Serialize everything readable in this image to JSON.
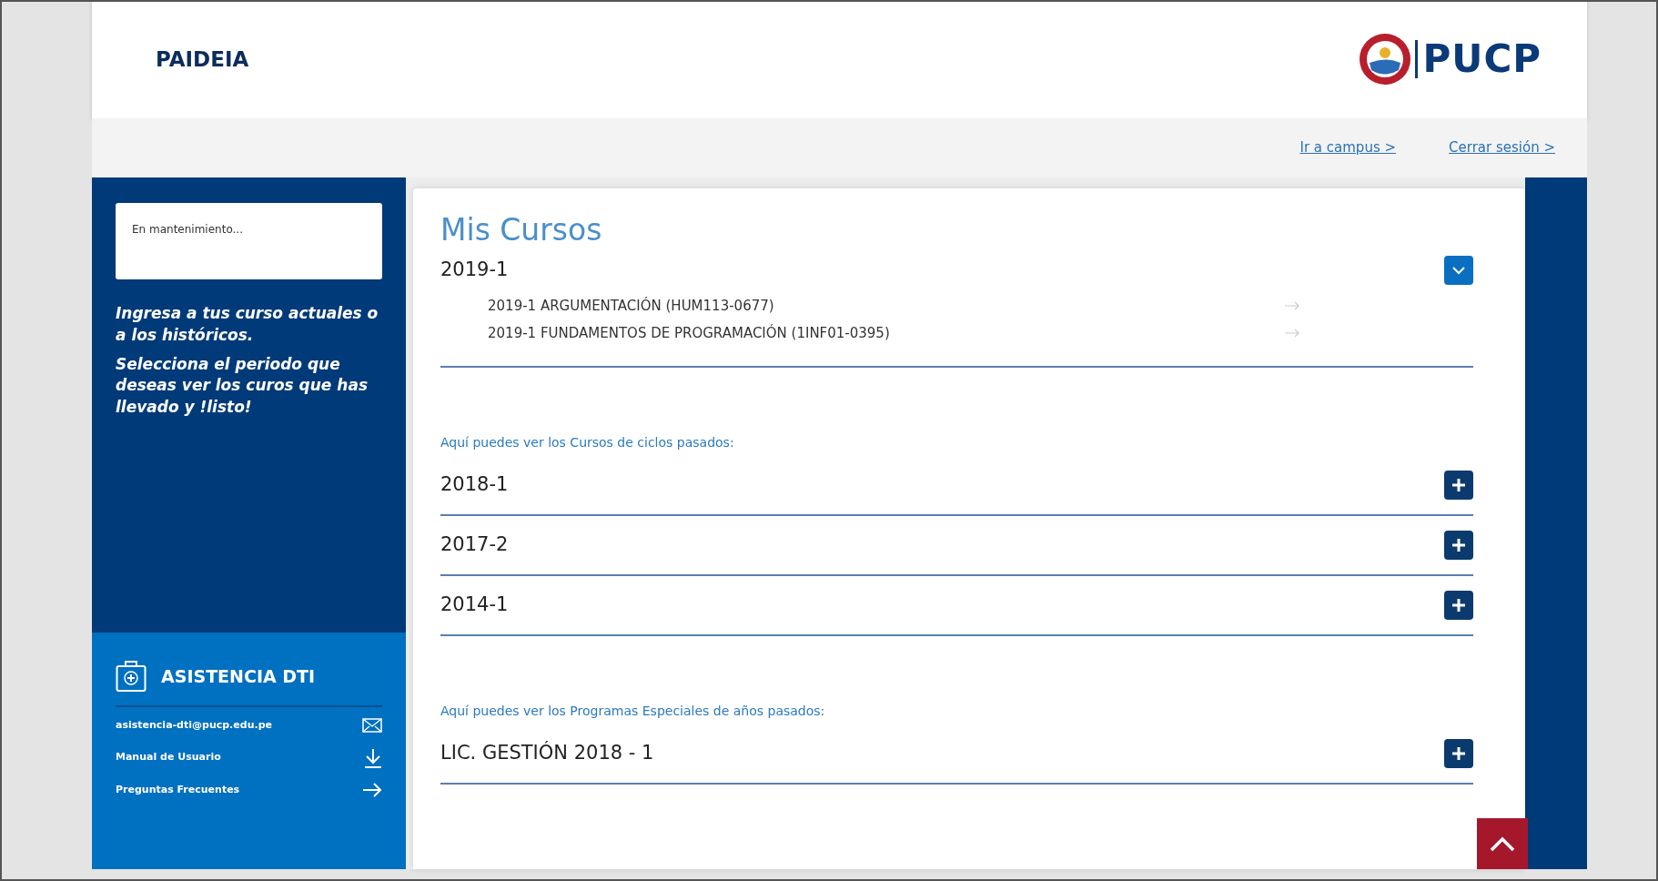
{
  "header": {
    "brand": "PAIDEIA",
    "logo_text": "PUCP"
  },
  "top_links": [
    "Ir a campus >",
    "Cerrar sesión >"
  ],
  "sidebar": {
    "notice": "En mantenimiento...",
    "intro": [
      "Ingresa a tus curso actuales o a los históricos.",
      "Selecciona el periodo que deseas ver los curos que has llevado y !listo!"
    ],
    "support": {
      "title": "ASISTENCIA DTI",
      "links": [
        {
          "label": "asistencia-dti@pucp.edu.pe",
          "kind": "mail"
        },
        {
          "label": "Manual de Usuario",
          "kind": "download"
        },
        {
          "label": "Preguntas Frecuentes",
          "kind": "arrow"
        }
      ]
    }
  },
  "main": {
    "title": "Mis Cursos",
    "groups": [
      {
        "periods": [
          {
            "label": "2019-1",
            "expanded": true,
            "courses": [
              "2019-1 ARGUMENTACIÓN (HUM113-0677)",
              "2019-1 FUNDAMENTOS DE PROGRAMACIÓN (1INF01-0395)"
            ]
          }
        ]
      },
      {
        "caption": "Aquí puedes ver los Cursos de ciclos pasados:",
        "periods": [
          {
            "label": "2018-1",
            "expanded": false
          },
          {
            "label": "2017-2",
            "expanded": false
          },
          {
            "label": "2014-1",
            "expanded": false
          }
        ]
      },
      {
        "caption": "Aquí puedes ver los Programas Especiales de años pasados:",
        "periods": [
          {
            "label": "LIC. GESTIÓN 2018 - 1",
            "expanded": false
          }
        ]
      }
    ]
  }
}
